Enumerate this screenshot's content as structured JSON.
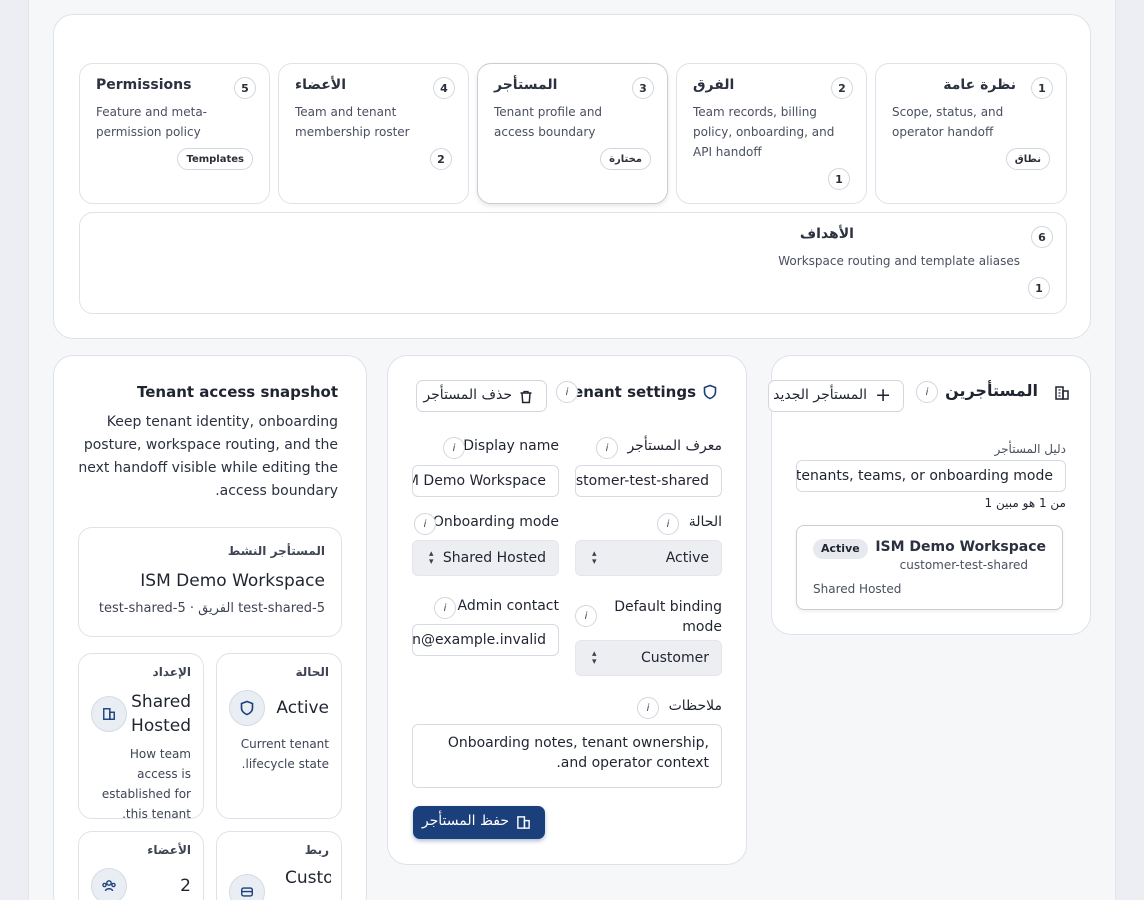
{
  "tabs": [
    {
      "num": "1",
      "title": "نظرة عامة",
      "desc": [
        "Scope, status, and",
        "operator handoff"
      ],
      "chip": "نطاق"
    },
    {
      "num": "2",
      "title": "الفرق",
      "desc": [
        "Team records, billing",
        "policy, onboarding, and",
        "API handoff"
      ],
      "count": "1"
    },
    {
      "num": "3",
      "title": "المستأجر",
      "desc": [
        "Tenant profile and",
        "access boundary"
      ],
      "chip": "مختارة"
    },
    {
      "num": "4",
      "title": "الأعضاء",
      "desc": [
        "Team and tenant",
        "membership roster"
      ],
      "count": "2"
    },
    {
      "num": "5",
      "title": "Permissions",
      "desc": [
        "Feature and meta-",
        "permission policy"
      ],
      "chip": "Templates"
    },
    {
      "num": "6",
      "title": "الأهداف",
      "desc": [
        "Workspace routing and template aliases"
      ],
      "count": "1"
    }
  ],
  "tenants": {
    "title": "المستأجرين",
    "new_button": "المستأجر الجديد",
    "search_label": "دليل المستأجر",
    "search_value": "Search tenants, teams, or onboarding mode",
    "count_text": "1 من 1 هو مبين",
    "item": {
      "name": "ISM Demo Workspace",
      "slug": "customer-test-shared",
      "badge": "Active",
      "mode": "Shared Hosted"
    }
  },
  "settings": {
    "title": "Tenant settings",
    "delete_button": "حذف المستأجر",
    "tenant_id_label": "معرف المستأجر",
    "tenant_id_value": "customer-test-shared",
    "display_name_label": "Display name",
    "display_name_value": "ISM Demo Workspace",
    "status_label": "الحالة",
    "status_value": "Active",
    "onboarding_label": "Onboarding mode",
    "onboarding_value": "Shared Hosted",
    "binding_label": "Default binding mode",
    "binding_value": "Customer",
    "admin_label": "Admin contact",
    "admin_value": "admin@example.invalid",
    "notes_label": "ملاحظات",
    "notes_value": "Onboarding notes, tenant ownership, and operator context.",
    "save_button": "حفظ المستأجر"
  },
  "snapshot": {
    "title": "Tenant access snapshot",
    "desc": "Keep tenant identity, onboarding posture, workspace routing, and the next handoff visible while editing the access boundary.",
    "active_label": "المستأجر النشط",
    "active_name": "ISM Demo Workspace",
    "active_sub": "test-shared-5 · الفريق test-shared-5",
    "status_label": "الحالة",
    "status_value": "Active",
    "status_desc": "Current tenant lifecycle state.",
    "setup_label": "الإعداد",
    "setup_value": "Shared Hosted",
    "setup_desc": "How team access is established for this tenant.",
    "binding_label": "ربط",
    "binding_value": "Customer",
    "members_label": "الأعضاء",
    "members_value": "2"
  }
}
